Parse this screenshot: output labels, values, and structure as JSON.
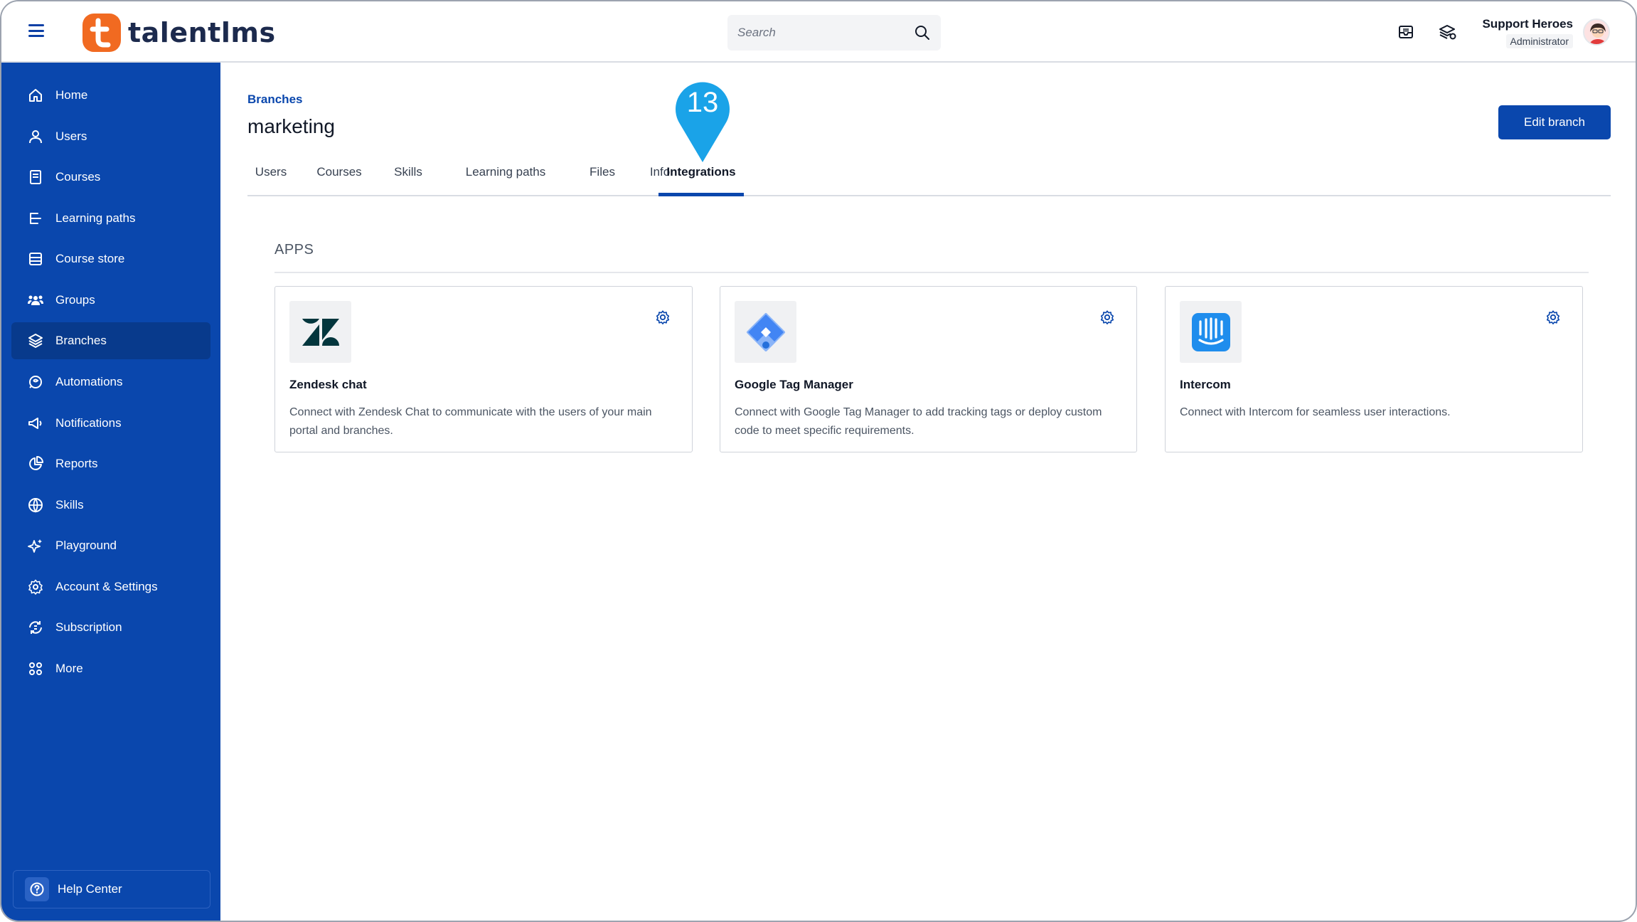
{
  "header": {
    "logo_text": "talentlms",
    "search_placeholder": "Search",
    "user_name": "Support Heroes",
    "user_role": "Administrator"
  },
  "sidebar": {
    "items": [
      {
        "label": "Home",
        "icon": "home-icon"
      },
      {
        "label": "Users",
        "icon": "user-icon"
      },
      {
        "label": "Courses",
        "icon": "book-icon"
      },
      {
        "label": "Learning paths",
        "icon": "learning-path-icon"
      },
      {
        "label": "Course store",
        "icon": "store-icon"
      },
      {
        "label": "Groups",
        "icon": "groups-icon"
      },
      {
        "label": "Branches",
        "icon": "layers-icon",
        "active": true
      },
      {
        "label": "Automations",
        "icon": "automation-icon"
      },
      {
        "label": "Notifications",
        "icon": "megaphone-icon"
      },
      {
        "label": "Reports",
        "icon": "pie-chart-icon"
      },
      {
        "label": "Skills",
        "icon": "skills-icon"
      },
      {
        "label": "Playground",
        "icon": "sparkle-icon"
      },
      {
        "label": "Account & Settings",
        "icon": "gear-icon"
      },
      {
        "label": "Subscription",
        "icon": "subscription-icon"
      },
      {
        "label": "More",
        "icon": "grid-icon"
      }
    ],
    "help_label": "Help Center"
  },
  "main": {
    "breadcrumb": "Branches",
    "title": "marketing",
    "edit_button": "Edit branch",
    "tabs": [
      {
        "label": "Users"
      },
      {
        "label": "Courses"
      },
      {
        "label": "Skills"
      },
      {
        "label": "Learning paths"
      },
      {
        "label": "Files"
      },
      {
        "label": "Info"
      },
      {
        "label": "Integrations",
        "active": true
      }
    ],
    "marker_number": "13",
    "section_title": "APPS",
    "apps": [
      {
        "name": "Zendesk chat",
        "description": "Connect with Zendesk Chat to communicate with the users of your main portal and branches.",
        "icon": "zendesk-logo-icon"
      },
      {
        "name": "Google Tag Manager",
        "description": "Connect with Google Tag Manager to add tracking tags or deploy custom code to meet specific requirements.",
        "icon": "google-tag-manager-logo-icon"
      },
      {
        "name": "Intercom",
        "description": "Connect with Intercom for seamless user interactions.",
        "icon": "intercom-logo-icon"
      }
    ]
  },
  "colors": {
    "brand_blue": "#0a47ad",
    "brand_orange": "#f16a21",
    "marker_blue": "#1aa3e8"
  }
}
